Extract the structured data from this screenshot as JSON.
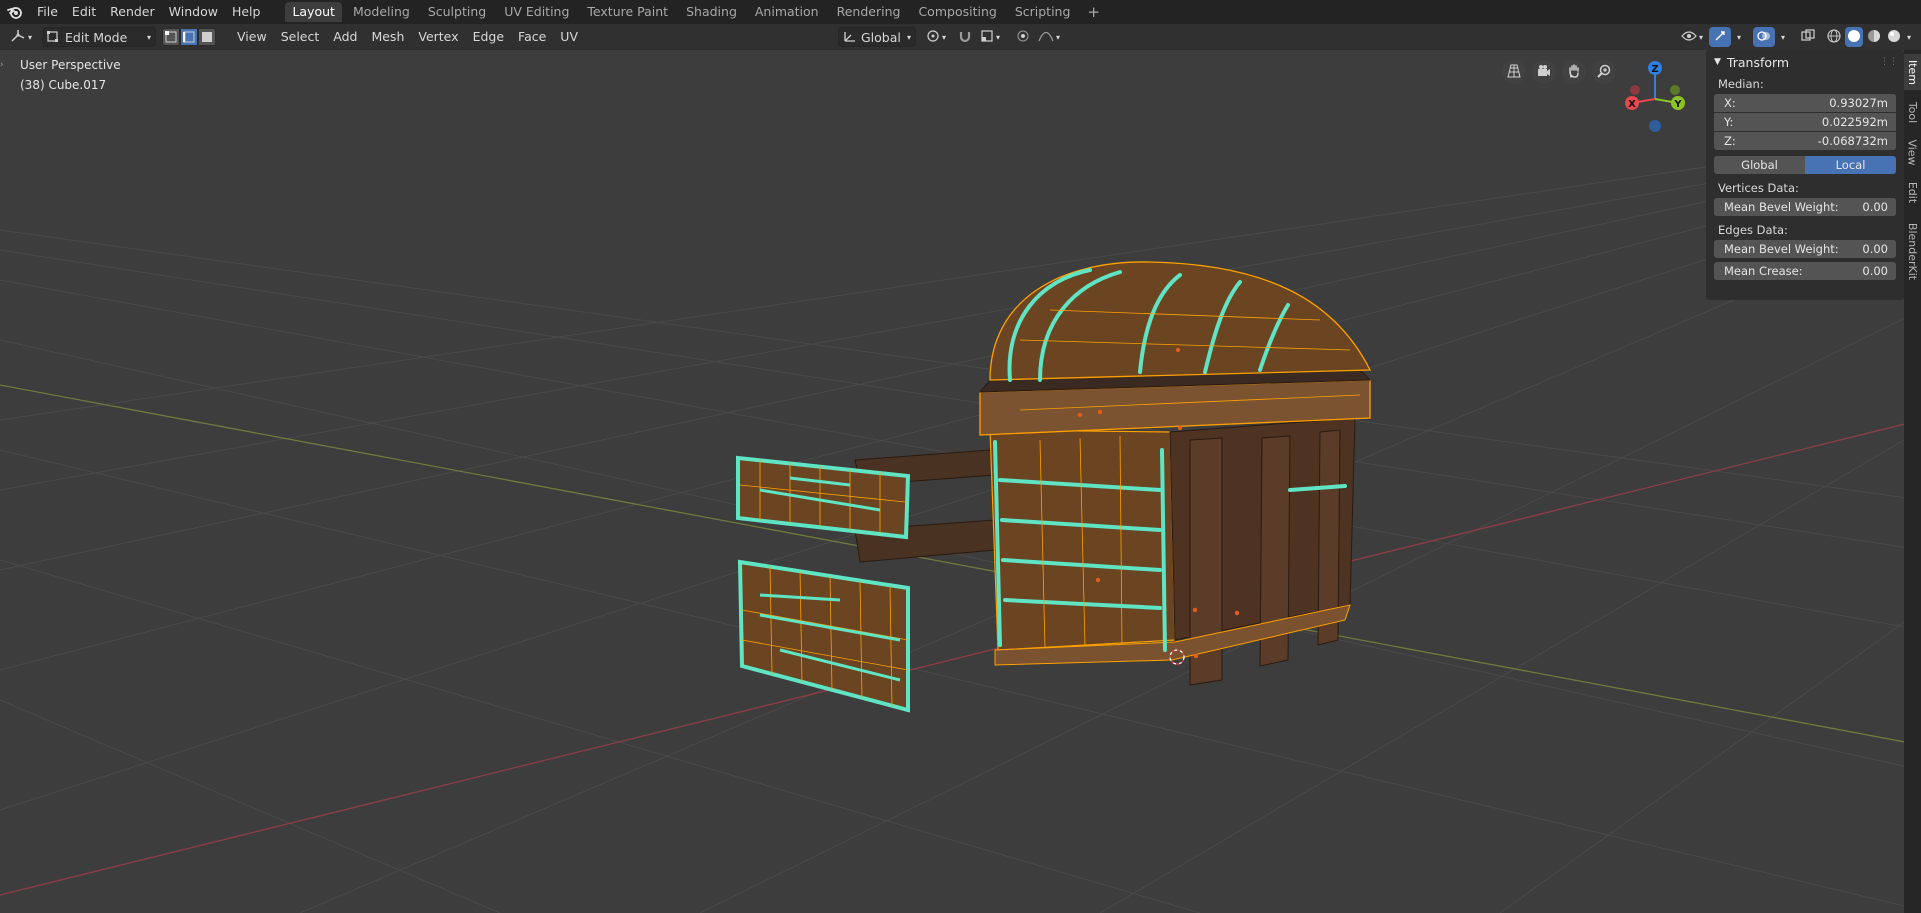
{
  "app": {
    "logo_icon": "blender-logo-icon"
  },
  "menu": [
    "File",
    "Edit",
    "Render",
    "Window",
    "Help"
  ],
  "workspaces": {
    "active": "Layout",
    "tabs": [
      "Layout",
      "Modeling",
      "Sculpting",
      "UV Editing",
      "Texture Paint",
      "Shading",
      "Animation",
      "Rendering",
      "Compositing",
      "Scripting"
    ],
    "add": "+"
  },
  "header": {
    "editor_type_icon": "3d-viewport-icon",
    "mode": "Edit Mode",
    "menus": [
      "View",
      "Select",
      "Add",
      "Mesh",
      "Vertex",
      "Edge",
      "Face",
      "UV"
    ],
    "transform_orientation": "Global",
    "select_mode_active": "edge"
  },
  "viewport": {
    "perspective": "User Perspective",
    "object_info": "(38) Cube.017"
  },
  "gizmo": {
    "x": "X",
    "y": "Y",
    "z": "Z"
  },
  "npanel": {
    "panel_title": "Transform",
    "median_label": "Median:",
    "fields": [
      {
        "axis": "X:",
        "value": "0.93027m"
      },
      {
        "axis": "Y:",
        "value": "0.022592m"
      },
      {
        "axis": "Z:",
        "value": "-0.068732m"
      }
    ],
    "space_options": [
      "Global",
      "Local"
    ],
    "space_active": "Local",
    "vertices_label": "Vertices Data:",
    "vertex_bevel": {
      "label": "Mean Bevel Weight:",
      "value": "0.00"
    },
    "edges_label": "Edges Data:",
    "edge_bevel": {
      "label": "Mean Bevel Weight:",
      "value": "0.00"
    },
    "edge_crease": {
      "label": "Mean Crease:",
      "value": "0.00"
    }
  },
  "side_tabs": [
    "Item",
    "Tool",
    "View",
    "Edit",
    "BlenderKit"
  ],
  "side_tab_active": "Item",
  "colors": {
    "selected_edge": "#ffa000",
    "seam": "#5fe4c4",
    "wood": "#6b4522",
    "wood_dark": "#4a3222",
    "x_axis": "#e8484e",
    "y_axis": "#8dc322",
    "z_axis": "#2f7fe5",
    "accent": "#4772b3"
  }
}
